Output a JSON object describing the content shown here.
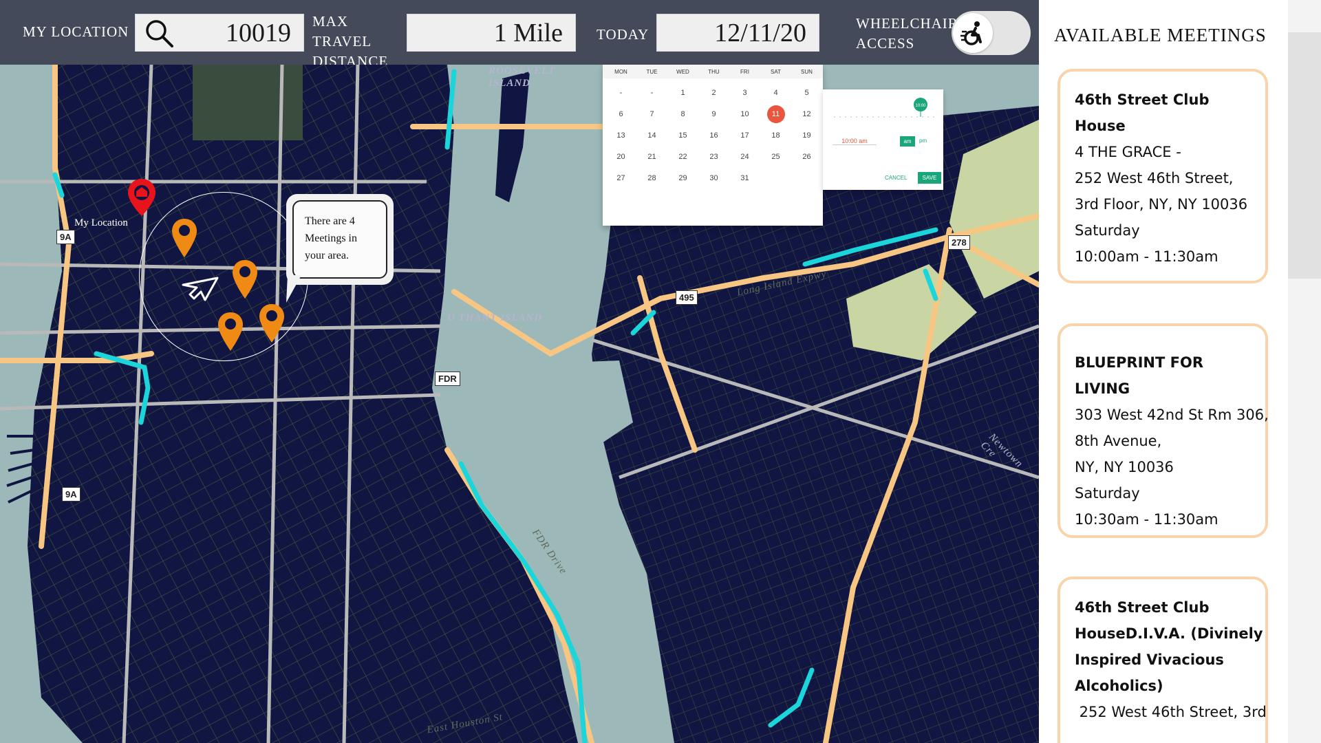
{
  "topbar": {
    "location_label": "MY LOCATION",
    "zip": "10019",
    "distance_label": "MAX TRAVEL DISTANCE",
    "distance_value": "1 Mile",
    "today_label": "TODAY",
    "date_value": "12/11/20",
    "wheelchair_label": "WHEELCHAIR ACCESS",
    "wheelchair_icon": "wheelchair-icon"
  },
  "map": {
    "my_location_label": "My Location",
    "bubble_text": "There are 4 Meetings in your area.",
    "labels": {
      "roosevelt": "ROOSEVELT ISLAND",
      "u_thant": "U THANT ISLAND",
      "fdr": "FDR",
      "r9a_top": "9A",
      "r9a_bottom": "9A",
      "r495": "495",
      "r278": "278",
      "newtown": "Newtown Cre",
      "houston": "East Houston St",
      "fdr_drive": "FDR Drive",
      "long_island_expwy": "Long Island Expwy"
    },
    "calendar": {
      "weekdays": [
        "MON",
        "TUE",
        "WED",
        "THU",
        "FRI",
        "SAT",
        "SUN"
      ],
      "days": [
        "-",
        "-",
        "1",
        "2",
        "3",
        "4",
        "5",
        "6",
        "7",
        "8",
        "9",
        "10",
        "11",
        "12",
        "13",
        "14",
        "15",
        "16",
        "17",
        "18",
        "19",
        "20",
        "21",
        "22",
        "23",
        "24",
        "25",
        "26",
        "27",
        "28",
        "29",
        "30",
        "31"
      ],
      "selected": "11",
      "time_value": "10:00 am",
      "am_label": "am",
      "pm_label": "pm",
      "cancel_label": "CANCEL",
      "save_label": "SAVE",
      "slider_value": "10:00"
    },
    "colors": {
      "water": "#9cb8b8",
      "land": "#111541",
      "highway": "#f7c683",
      "cyan_route": "#1ad5d9",
      "pin": "#ef8a14",
      "my_location_pin": "#e8141c"
    }
  },
  "panel": {
    "title": "AVAILABLE MEETINGS",
    "meetings": [
      {
        "title": "46th Street Club House",
        "lines": [
          "4 THE GRACE -",
          "252 West 46th Street,",
          "3rd Floor, NY, NY 10036",
          "Saturday",
          "10:00am - 11:30am"
        ]
      },
      {
        "title": "BLUEPRINT FOR LIVING",
        "lines": [
          "303 West 42nd St Rm 306,",
          "8th Avenue,",
          "NY, NY 10036",
          "Saturday",
          "10:30am - 11:30am"
        ]
      },
      {
        "title_lines": [
          "46th Street Club",
          "HouseD.I.V.A. (Divinely",
          "Inspired Vivacious",
          "Alcoholics)"
        ],
        "lines": [
          " 252 West 46th Street, 3rd"
        ]
      }
    ]
  }
}
